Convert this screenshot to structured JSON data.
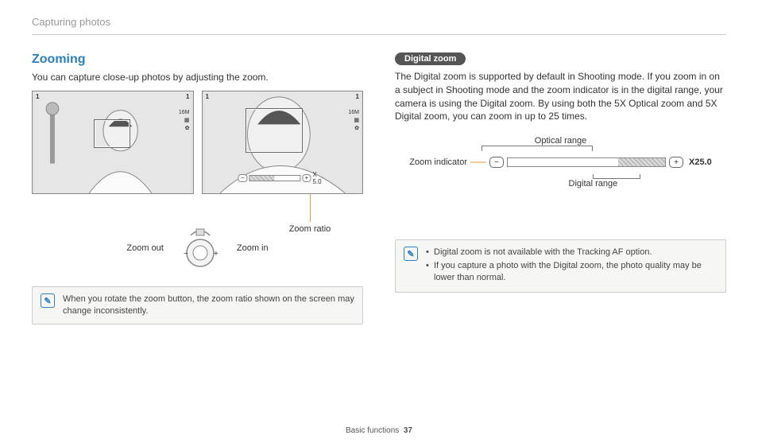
{
  "breadcrumb": "Capturing photos",
  "left": {
    "title": "Zooming",
    "intro": "You can capture close-up photos by adjusting the zoom.",
    "thumb_status": {
      "left": "1",
      "right": "1"
    },
    "thumb_side": {
      "res": "16M",
      "icon2": "✿",
      "icon3": "✿"
    },
    "zoom_bar": {
      "minus": "−",
      "plus": "+",
      "value": "X 5.0"
    },
    "zoom_ratio_label": "Zoom ratio",
    "zoom_out_label": "Zoom out",
    "zoom_in_label": "Zoom in",
    "note1": "When you rotate the zoom button, the zoom ratio shown on the screen may change inconsistently."
  },
  "right": {
    "pill": "Digital zoom",
    "body": "The Digital zoom is supported by default in Shooting mode. If you zoom in on a subject in Shooting mode and the zoom indicator is in the digital range, your camera is using the Digital zoom. By using both the 5X Optical zoom and 5X Digital zoom, you can zoom in up to 25 times.",
    "optical_label": "Optical range",
    "digital_label": "Digital range",
    "zoom_indicator_label": "Zoom indicator",
    "zoom_value": "X25.0",
    "note_items": [
      "Digital zoom is not available with the Tracking AF option.",
      "If you capture a photo with the Digital zoom, the photo quality may be lower than normal."
    ]
  },
  "footer": {
    "section": "Basic functions",
    "page": "37"
  }
}
